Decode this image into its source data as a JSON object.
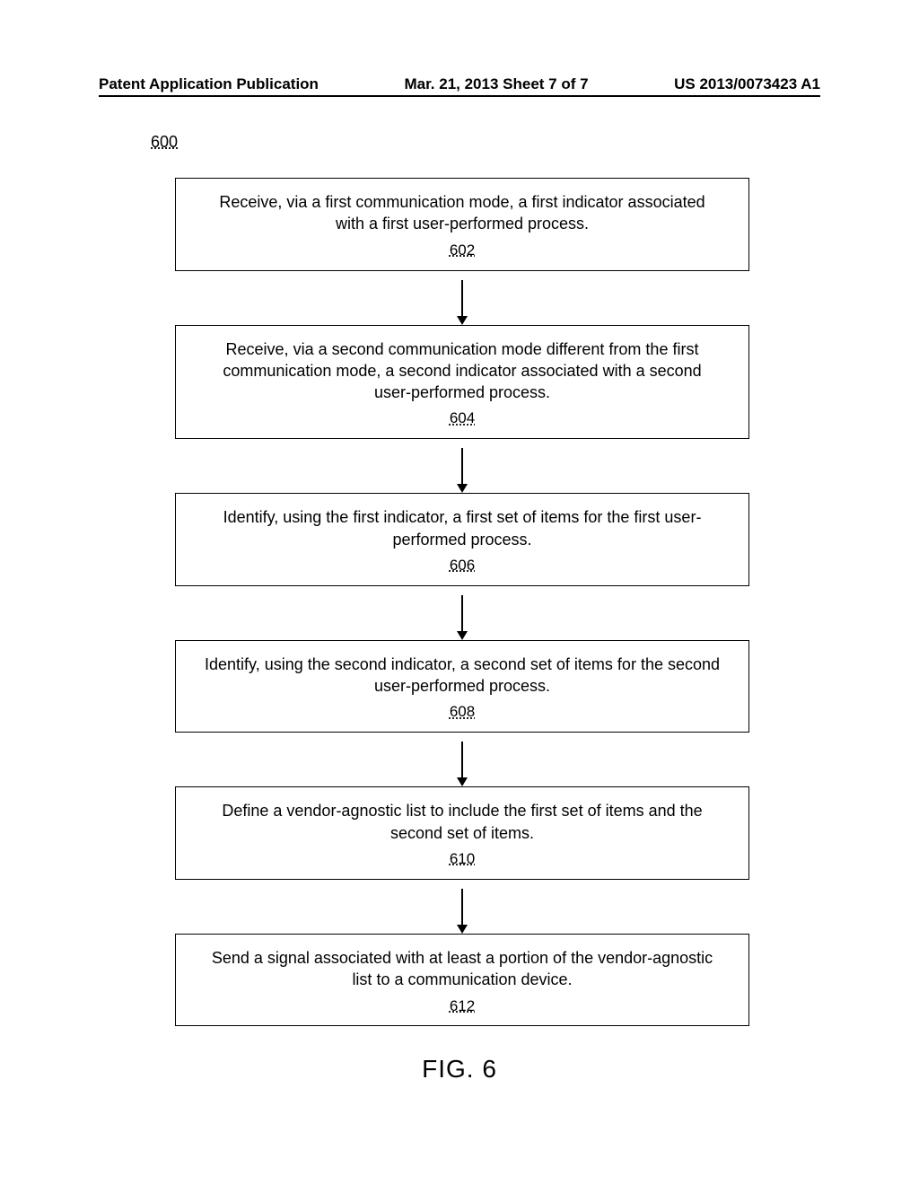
{
  "header": {
    "left": "Patent Application Publication",
    "center": "Mar. 21, 2013  Sheet 7 of 7",
    "right": "US 2013/0073423 A1"
  },
  "figure_ref": "600",
  "figure_label": "FIG. 6",
  "chart_data": {
    "type": "flowchart",
    "title": "600",
    "nodes": [
      {
        "id": "602",
        "text": "Receive, via a first communication mode, a first indicator associated with a first user-performed process."
      },
      {
        "id": "604",
        "text": "Receive, via a second communication mode different from the first communication mode, a second indicator associated with a second user-performed process."
      },
      {
        "id": "606",
        "text": "Identify, using the first indicator, a first set of items for the first user-performed process."
      },
      {
        "id": "608",
        "text": "Identify, using the second indicator, a second set of items for the second user-performed process."
      },
      {
        "id": "610",
        "text": "Define a vendor-agnostic list to include the first set of items and the second set of items."
      },
      {
        "id": "612",
        "text": "Send a signal associated with at least a portion of the vendor-agnostic list to a communication device."
      }
    ],
    "edges": [
      {
        "from": "602",
        "to": "604"
      },
      {
        "from": "604",
        "to": "606"
      },
      {
        "from": "606",
        "to": "608"
      },
      {
        "from": "608",
        "to": "610"
      },
      {
        "from": "610",
        "to": "612"
      }
    ]
  }
}
